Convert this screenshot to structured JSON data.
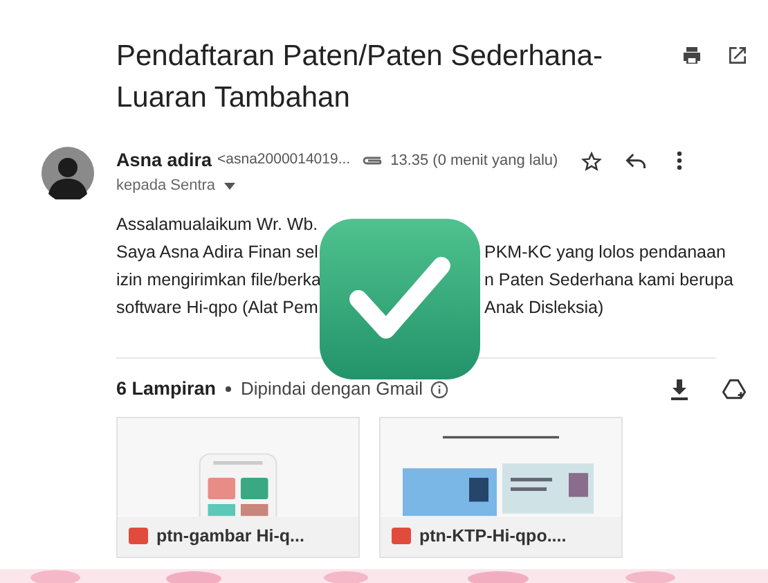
{
  "email": {
    "subject": "Pendaftaran Paten/Paten Sederhana-Luaran Tambahan",
    "sender": {
      "name": "Asna adira",
      "address": "<asna2000014019...",
      "time": "13.35 (0 menit yang lalu)",
      "recipient": "kepada Sentra",
      "starred": false
    },
    "body_lines": [
      {
        "left": "Assalamualaikum Wr. Wb."
      },
      {
        "left": "Saya Asna Adira Finan sel",
        "right": "PKM-KC yang lolos pendanaan"
      },
      {
        "left": "izin mengirimkan file/berka",
        "right": "n Paten Sederhana kami berupa"
      },
      {
        "left": "software Hi-qpo (Alat Pem",
        "right": "Anak Disleksia)"
      }
    ],
    "attachments": {
      "count_label": "6 Lampiran",
      "scan_note": "Dipindai dengan Gmail",
      "files": [
        {
          "name": "ptn-gambar Hi-q...",
          "kind": "phone"
        },
        {
          "name": "ptn-KTP-Hi-qpo....",
          "kind": "id"
        }
      ]
    }
  },
  "overlay": {
    "kind": "check"
  }
}
